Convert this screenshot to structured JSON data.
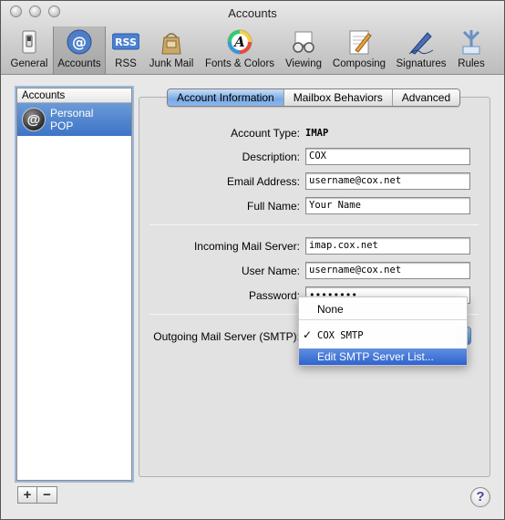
{
  "window": {
    "title": "Accounts"
  },
  "toolbar": {
    "items": [
      {
        "label": "General"
      },
      {
        "label": "Accounts"
      },
      {
        "label": "RSS"
      },
      {
        "label": "Junk Mail"
      },
      {
        "label": "Fonts & Colors"
      },
      {
        "label": "Viewing"
      },
      {
        "label": "Composing"
      },
      {
        "label": "Signatures"
      },
      {
        "label": "Rules"
      }
    ],
    "rss_badge": "RSS",
    "fonts_glyph": "A",
    "selected": "Accounts"
  },
  "accounts_list": {
    "header": "Accounts",
    "items": [
      {
        "name": "Personal",
        "type": "POP",
        "icon_glyph": "@"
      }
    ],
    "add_label": "+",
    "remove_label": "−"
  },
  "tabs": [
    {
      "label": "Account Information",
      "active": true
    },
    {
      "label": "Mailbox Behaviors",
      "active": false
    },
    {
      "label": "Advanced",
      "active": false
    }
  ],
  "form": {
    "account_type": {
      "label": "Account Type:",
      "value": "IMAP"
    },
    "description": {
      "label": "Description:",
      "value": "COX"
    },
    "email": {
      "label": "Email Address:",
      "value": "username@cox.net"
    },
    "full_name": {
      "label": "Full Name:",
      "value": "Your Name"
    },
    "incoming_server": {
      "label": "Incoming Mail Server:",
      "value": "imap.cox.net"
    },
    "user_name": {
      "label": "User Name:",
      "value": "username@cox.net"
    },
    "password": {
      "label": "Password:",
      "value": "••••••••"
    },
    "smtp": {
      "label": "Outgoing Mail Server (SMTP):"
    }
  },
  "smtp_menu": {
    "items": [
      {
        "label": "None",
        "checked": false,
        "check_glyph": ""
      },
      {
        "label": "COX SMTP",
        "checked": true,
        "check_glyph": "✓"
      },
      {
        "label": "Edit SMTP Server List...",
        "highlighted": true,
        "check_glyph": ""
      }
    ]
  },
  "help": {
    "label": "?"
  },
  "colors": {
    "selection": "#3d74c6",
    "tab_active": "#79a9e3",
    "menu_highlight": "#2f63cf"
  }
}
